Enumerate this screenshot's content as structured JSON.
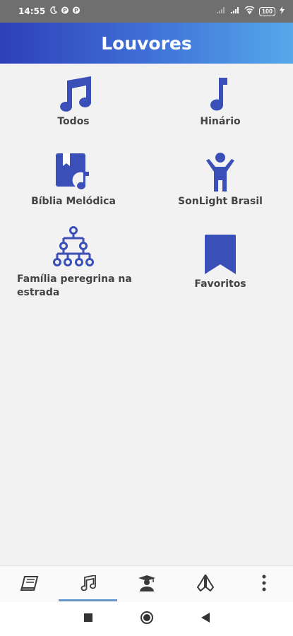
{
  "status_bar": {
    "time": "14:55",
    "notifications": [
      "moon-icon",
      "p-icon",
      "p-icon"
    ],
    "battery": "100"
  },
  "app_bar": {
    "title": "Louvores"
  },
  "tiles": [
    {
      "label": "Todos",
      "icon": "music-notes-icon"
    },
    {
      "label": "Hinário",
      "icon": "music-note-icon"
    },
    {
      "label": "Bíblia Melódica",
      "icon": "book-music-icon"
    },
    {
      "label": "SonLight Brasil",
      "icon": "child-icon"
    },
    {
      "label": "Família peregrina na estrada",
      "icon": "family-tree-icon"
    },
    {
      "label": "Favoritos",
      "icon": "bookmark-icon"
    }
  ],
  "bottom_nav": {
    "items": [
      "book-icon",
      "music-note-icon",
      "graduate-icon",
      "praying-hands-icon",
      "more-vert-icon"
    ],
    "selected": 1
  },
  "colors": {
    "accent": "#3a4fb8",
    "gradient_start": "#2e3fb8",
    "gradient_end": "#55a8ea",
    "label": "#444444"
  }
}
